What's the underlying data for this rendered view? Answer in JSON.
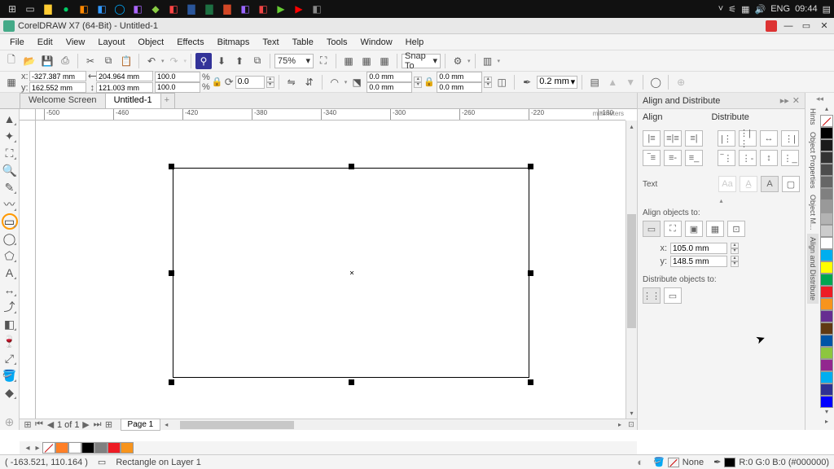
{
  "taskbar": {
    "right": {
      "lang": "ENG",
      "time": "09:44"
    }
  },
  "titlebar": {
    "title": "CorelDRAW X7 (64-Bit) - Untitled-1"
  },
  "menu": [
    "File",
    "Edit",
    "View",
    "Layout",
    "Object",
    "Effects",
    "Bitmaps",
    "Text",
    "Table",
    "Tools",
    "Window",
    "Help"
  ],
  "toolbar1": {
    "zoom": "75%",
    "snap": "Snap To"
  },
  "toolbar2": {
    "x": "-327.387 mm",
    "y": "162.552 mm",
    "w": "204.964 mm",
    "h": "121.003 mm",
    "sx": "100.0",
    "sy": "100.0",
    "scale_unit": "%",
    "rot": "0.0",
    "dim_a": "0.0 mm",
    "dim_b": "0.0 mm",
    "dim_c": "0.0 mm",
    "dim_d": "0.0 mm",
    "outline": "0.2 mm"
  },
  "tabs": {
    "welcome": "Welcome Screen",
    "doc": "Untitled-1"
  },
  "ruler": {
    "unit": "millimeters",
    "marks": [
      "-500",
      "-460",
      "-420",
      "-380",
      "-340",
      "-300",
      "-260",
      "-220",
      "-180"
    ]
  },
  "page": {
    "counter": "1 of 1",
    "tab": "Page 1"
  },
  "docker": {
    "title": "Align and Distribute",
    "align_hdr": "Align",
    "dist_hdr": "Distribute",
    "text_lbl": "Text",
    "align_to": "Align objects to:",
    "dist_to": "Distribute objects to:",
    "cx": "105.0 mm",
    "cy": "148.5 mm",
    "cxl": "x:",
    "cyl": "y:"
  },
  "rightdock": {
    "tabs": [
      "Hints",
      "Object Properties",
      "Object M...",
      "Align and Distribute"
    ]
  },
  "palette": [
    "#000000",
    "#1a1a1a",
    "#333333",
    "#4d4d4d",
    "#666666",
    "#808080",
    "#999999",
    "#b3b3b3",
    "#cccccc",
    "#ffffff",
    "#00aeef",
    "#ffff00",
    "#00a651",
    "#ed1c24",
    "#f7941d",
    "#662d91",
    "#603913",
    "#0054a6",
    "#8dc63f",
    "#92278f",
    "#00aef0",
    "#2e3192",
    "#0000ff"
  ],
  "bottom_palette": [
    "#ff7f27",
    "#ffffff",
    "#000000",
    "#808080",
    "#ed1c24",
    "#f7941d"
  ],
  "status": {
    "coords": "( -163.521, 110.164 )",
    "obj": "Rectangle on Layer 1",
    "fill_none": "None",
    "outline": "R:0 G:0 B:0 (#000000)"
  }
}
